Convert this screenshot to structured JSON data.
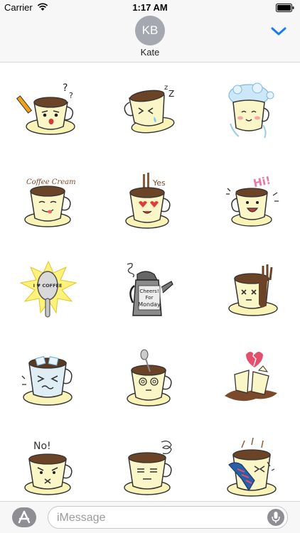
{
  "status_bar": {
    "carrier": "Carrier",
    "time": "1:17 AM",
    "icons": [
      "wifi-icon",
      "battery-icon"
    ]
  },
  "header": {
    "avatar_initials": "KB",
    "contact_name": "Kate",
    "chevron_icon": "chevron-down-icon",
    "accent_color": "#1a7cf5"
  },
  "stickers": {
    "s2_caption": "Coffee Cream",
    "s5_caption": "Yes",
    "s6_caption": "Hi!",
    "s7_caption": "I ♥ COFFEE",
    "s8_caption_line1": "Cheers!",
    "s8_caption_line2": "For",
    "s8_caption_line3": "Monday",
    "s13_caption": "No!"
  },
  "input_bar": {
    "placeholder": "iMessage",
    "app_icon": "appstore-icon",
    "mic_icon": "microphone-icon"
  }
}
